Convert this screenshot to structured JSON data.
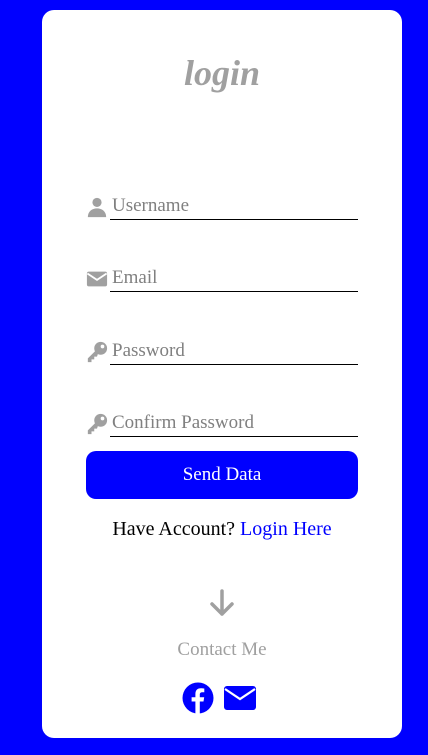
{
  "login": {
    "title": "login",
    "fields": [
      {
        "icon": "user-icon",
        "placeholder": "Username"
      },
      {
        "icon": "envelope-icon",
        "placeholder": "Email"
      },
      {
        "icon": "key-icon",
        "placeholder": "Password"
      },
      {
        "icon": "key-icon",
        "placeholder": "Confirm Password"
      }
    ],
    "submit_label": "Send Data",
    "account_prompt": "Have Account?",
    "login_link": "Login Here",
    "contact_label": "Contact Me",
    "social": [
      {
        "icon": "facebook-icon"
      },
      {
        "icon": "envelope-icon"
      }
    ]
  },
  "colors": {
    "background": "#0000ff",
    "card": "#ffffff",
    "muted": "#a0a0a0",
    "accent": "#0000ff"
  }
}
